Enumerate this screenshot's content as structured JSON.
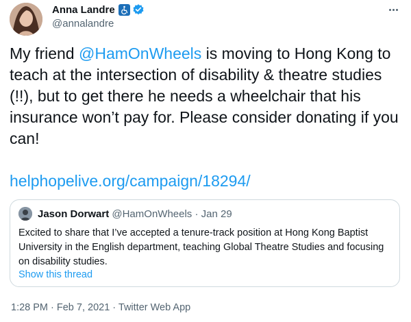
{
  "author": {
    "display_name": "Anna Landre",
    "handle": "@annalandre",
    "accessibility_badge_icon": "wheelchair-icon",
    "verified_icon": "verified-badge-icon"
  },
  "more_icon": "more-options-icon",
  "tweet": {
    "text_before": "My friend ",
    "mention": "@HamOnWheels",
    "text_after": " is moving to Hong Kong to teach at the intersection of disability & theatre studies (!!), but to get there he needs a wheelchair that his insurance won’t pay for. Please consider donating if you can!",
    "link": "helphopelive.org/campaign/18294/"
  },
  "quoted": {
    "name": "Jason Dorwart",
    "handle": "@HamOnWheels",
    "separator": "·",
    "date": "Jan 29",
    "text": "Excited to share that I’ve accepted a tenure-track position at Hong Kong Baptist University in the English department, teaching Global Theatre Studies and focusing on disability studies.",
    "show_thread": "Show this thread"
  },
  "meta": "1:28 PM · Feb 7, 2021 · Twitter Web App",
  "colors": {
    "accent": "#1d9bf0",
    "secondary": "#536471",
    "border": "#cfd9de"
  }
}
